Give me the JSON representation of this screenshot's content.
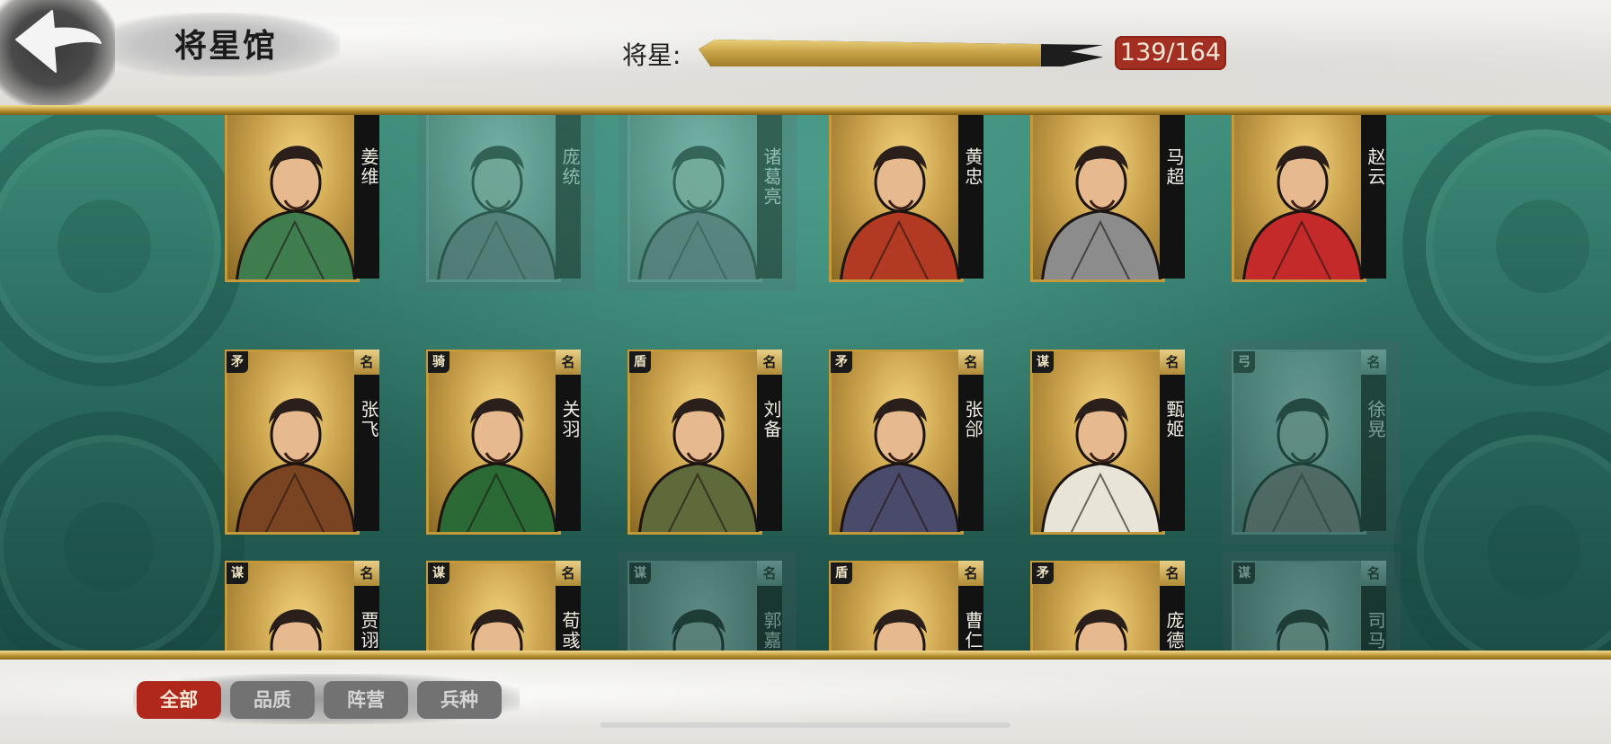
{
  "header": {
    "title": "将星馆",
    "progress_label": "将星:",
    "progress_value": 139,
    "progress_max": 164,
    "progress_text": "139/164"
  },
  "rows": [
    {
      "cards": [
        {
          "name": "姜维",
          "type_badge": "",
          "rank_badge": "",
          "owned": true,
          "accent": "#3f7d4e"
        },
        {
          "name": "庞统",
          "type_badge": "",
          "rank_badge": "",
          "owned": false,
          "accent": "#5b7b60"
        },
        {
          "name": "诸葛亮",
          "type_badge": "",
          "rank_badge": "",
          "owned": false,
          "accent": "#5b7b60"
        },
        {
          "name": "黄忠",
          "type_badge": "",
          "rank_badge": "",
          "owned": true,
          "accent": "#b23a22"
        },
        {
          "name": "马超",
          "type_badge": "",
          "rank_badge": "",
          "owned": true,
          "accent": "#8c8c8c"
        },
        {
          "name": "赵云",
          "type_badge": "",
          "rank_badge": "",
          "owned": true,
          "accent": "#c42a2a"
        }
      ]
    },
    {
      "cards": [
        {
          "name": "张飞",
          "type_badge": "矛",
          "rank_badge": "名",
          "owned": true,
          "accent": "#7a4322"
        },
        {
          "name": "关羽",
          "type_badge": "骑",
          "rank_badge": "名",
          "owned": true,
          "accent": "#2b6a35"
        },
        {
          "name": "刘备",
          "type_badge": "盾",
          "rank_badge": "名",
          "owned": true,
          "accent": "#5f6a3a"
        },
        {
          "name": "张郃",
          "type_badge": "矛",
          "rank_badge": "名",
          "owned": true,
          "accent": "#4a4a6a"
        },
        {
          "name": "甄姬",
          "type_badge": "谋",
          "rank_badge": "名",
          "owned": true,
          "accent": "#e8e4d8"
        },
        {
          "name": "徐晃",
          "type_badge": "弓",
          "rank_badge": "名",
          "owned": false,
          "accent": "#6a7fa0"
        }
      ]
    },
    {
      "cards": [
        {
          "name": "贾诩",
          "type_badge": "谋",
          "rank_badge": "名",
          "owned": true,
          "accent": "#2d2d5a"
        },
        {
          "name": "荀彧",
          "type_badge": "谋",
          "rank_badge": "名",
          "owned": true,
          "accent": "#3a3050"
        },
        {
          "name": "郭嘉",
          "type_badge": "谋",
          "rank_badge": "名",
          "owned": false,
          "accent": "#6a8aa8"
        },
        {
          "name": "曹仁",
          "type_badge": "盾",
          "rank_badge": "名",
          "owned": true,
          "accent": "#a8241e"
        },
        {
          "name": "庞德",
          "type_badge": "矛",
          "rank_badge": "名",
          "owned": true,
          "accent": "#4a3850"
        },
        {
          "name": "司马懿",
          "type_badge": "谋",
          "rank_badge": "名",
          "owned": false,
          "accent": "#3a4a78"
        }
      ]
    }
  ],
  "filters": [
    {
      "label": "全部",
      "active": true
    },
    {
      "label": "品质",
      "active": false
    },
    {
      "label": "阵营",
      "active": false
    },
    {
      "label": "兵种",
      "active": false
    }
  ],
  "icons": {
    "back": "back-arrow-icon"
  }
}
